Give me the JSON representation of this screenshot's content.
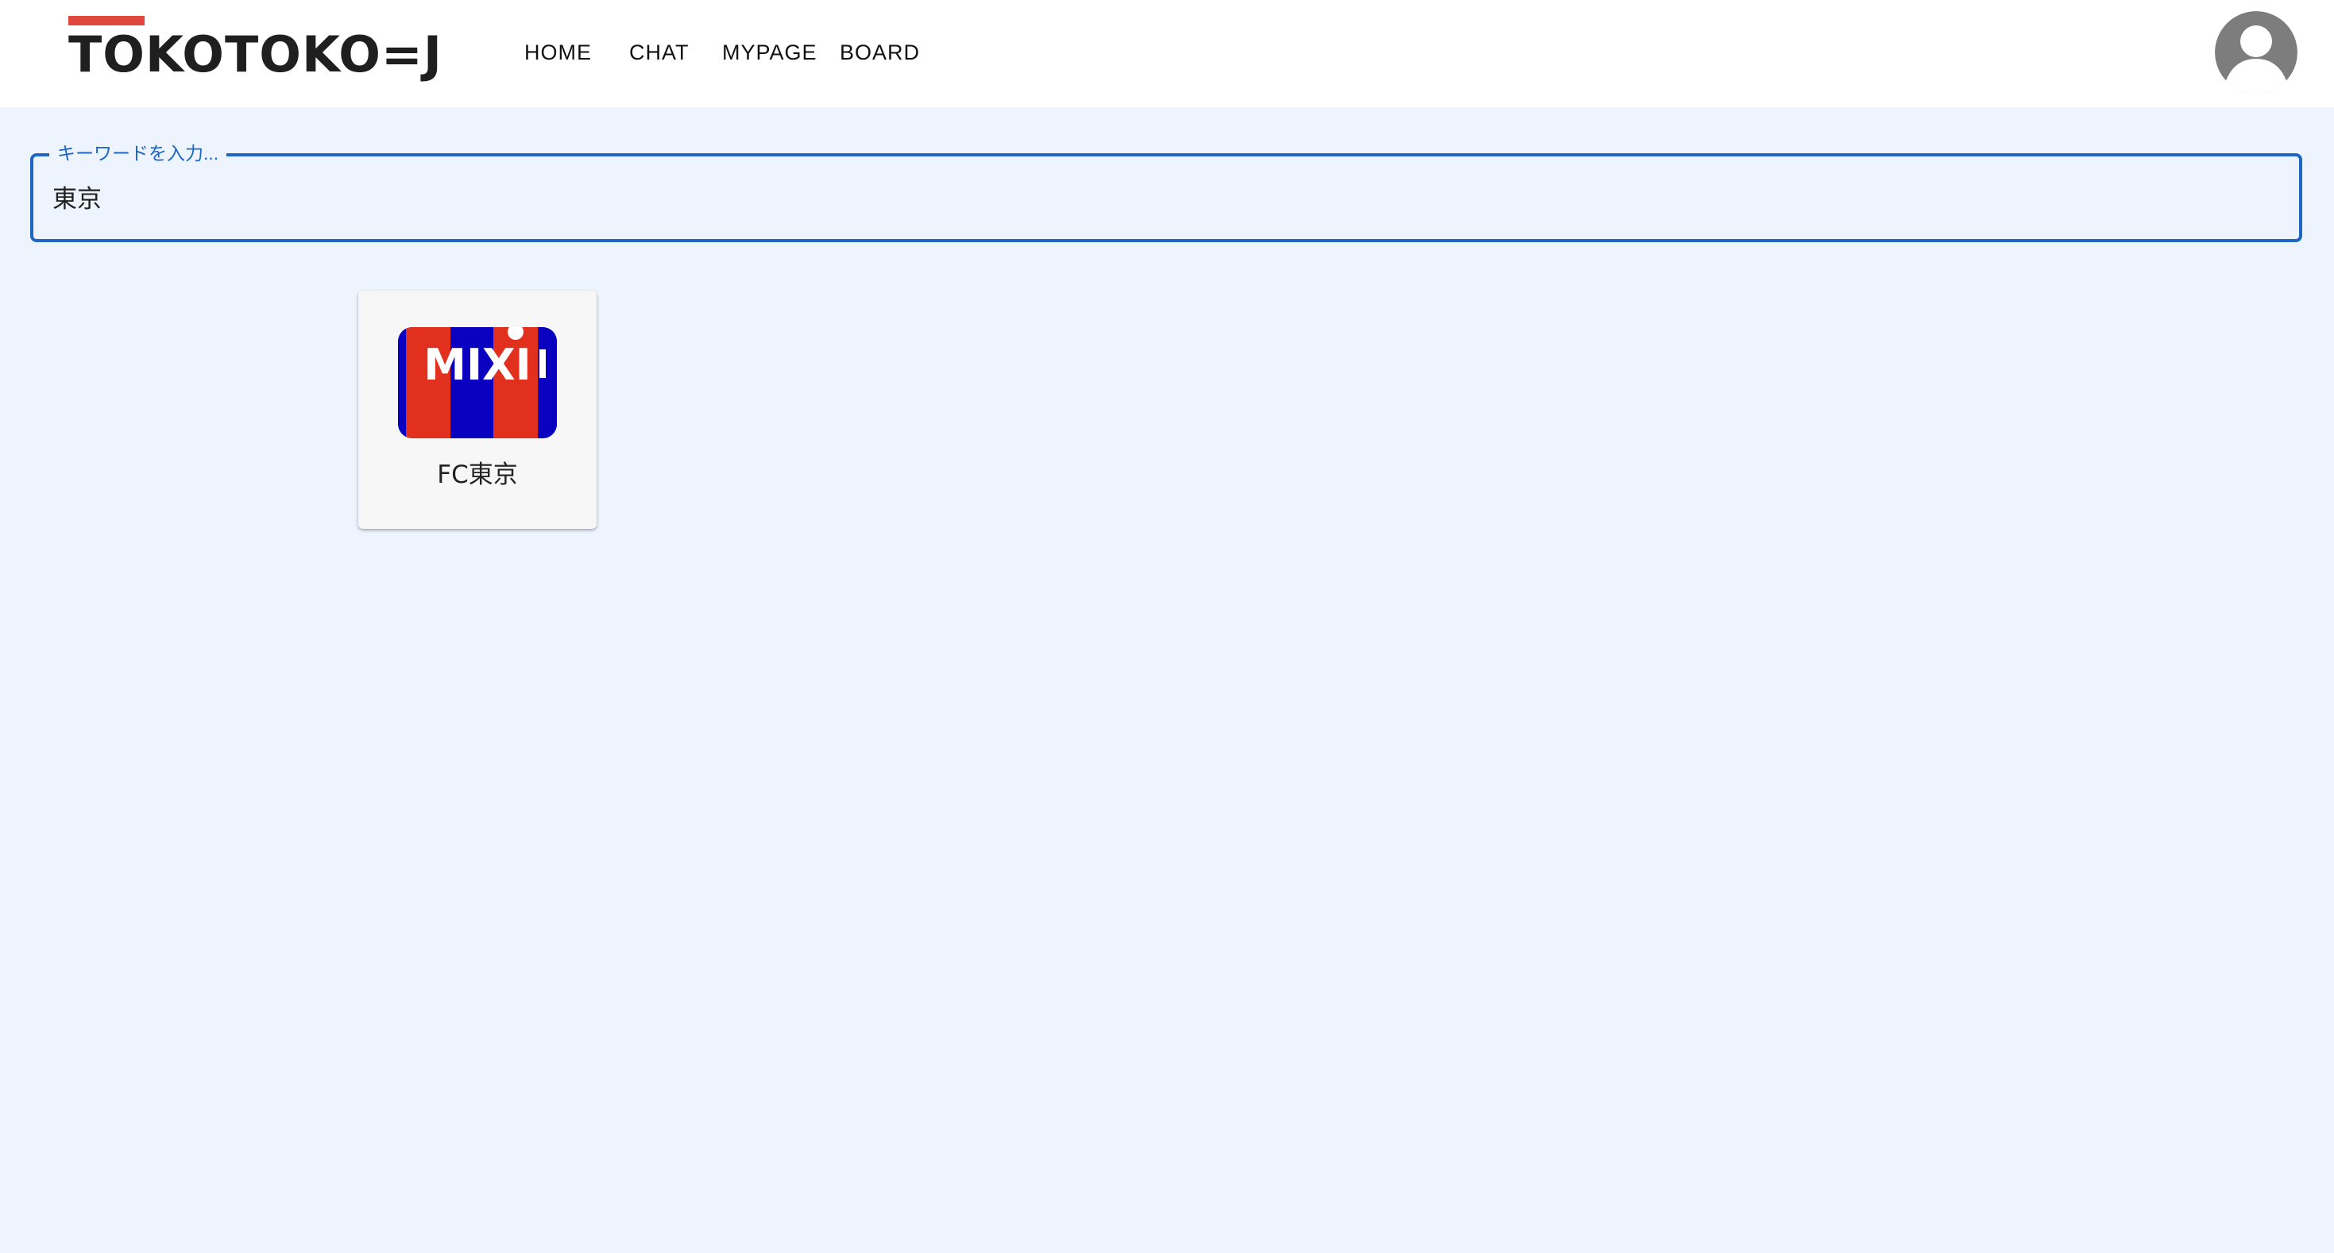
{
  "header": {
    "logo_text": "TOKOTOKO=J",
    "logo_accent_color": "#e0483e",
    "nav": [
      {
        "label": "HOME"
      },
      {
        "label": "CHAT"
      },
      {
        "label": "MYPAGE"
      },
      {
        "label": "BOARD"
      }
    ],
    "avatar_icon": "user-avatar-icon"
  },
  "search": {
    "label": "キーワードを入力...",
    "value": "東京",
    "accent_color": "#1e66c4"
  },
  "results": [
    {
      "name": "FC東京",
      "image_text": "MIXI",
      "image_colors": {
        "red": "#e2301f",
        "blue": "#0a00c0"
      }
    }
  ],
  "colors": {
    "background": "#edf4fe",
    "header_bg": "#ffffff"
  }
}
